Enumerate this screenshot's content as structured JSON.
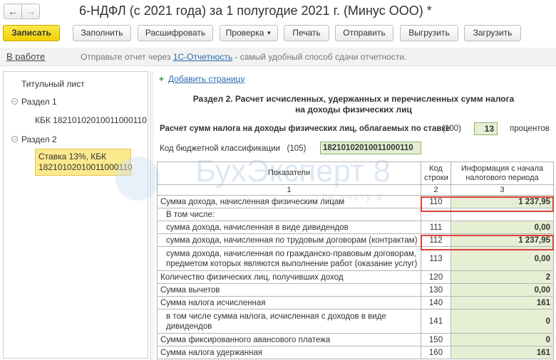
{
  "window": {
    "title": "6-НДФЛ (с 2021 года) за 1 полугодие 2021 г. (Минус ООО) *",
    "back_icon": "←",
    "forward_icon": "→"
  },
  "toolbar": {
    "save": "Записать",
    "fill": "Заполнить",
    "decode": "Расшифровать",
    "check": "Проверка",
    "print": "Печать",
    "send": "Отправить",
    "export": "Выгрузить",
    "import": "Загрузить"
  },
  "status": {
    "state": "В работе",
    "msg_before": "Отправьте отчет через ",
    "msg_link": "1С-Отчетность",
    "msg_after": " - самый удобный способ сдачи отчетности."
  },
  "sidebar": {
    "items": [
      {
        "label": "Титульный лист"
      },
      {
        "label": "Раздел 1"
      },
      {
        "label": "КБК 18210102010011000110"
      },
      {
        "label": "Раздел 2"
      },
      {
        "label_line1": "Ставка 13%, КБК",
        "label_line2": "18210102010011000110"
      }
    ]
  },
  "content": {
    "add_page": "Добавить страницу",
    "section_title_line1": "Раздел 2. Расчет исчисленных, удержанных и перечисленных сумм налога",
    "section_title_line2": "на доходы физических лиц",
    "rate_label": "Расчет сумм налога на доходы физических лиц, облагаемых по ставке",
    "rate_code": "(100)",
    "rate_value": "13",
    "rate_unit": "процентов",
    "kbk_label": "Код бюджетной классификации",
    "kbk_code": "(105)",
    "kbk_value": "18210102010011000110"
  },
  "watermark": {
    "text": "БухЭксперт 8",
    "sub": "по учету в"
  },
  "table": {
    "headers": [
      "Показатели",
      "Код строки",
      "Информация с начала налогового периода"
    ],
    "header_nums": [
      "1",
      "2",
      "3"
    ],
    "rows": [
      {
        "label": "Сумма дохода, начисленная физическим лицам",
        "code": "110",
        "value": "1 237,95"
      },
      {
        "label": "В том числе:",
        "code": "",
        "value": ""
      },
      {
        "label": "сумма дохода, начисленная в виде дивидендов",
        "code": "111",
        "value": "0,00"
      },
      {
        "label": "сумма дохода, начисленная по трудовым договорам (контрактам)",
        "code": "112",
        "value": "1 237,95"
      },
      {
        "label": "сумма дохода, начисленная по гражданско-правовым договорам, предметом которых являются выполнение работ (оказание услуг)",
        "code": "113",
        "value": "0,00"
      },
      {
        "label": "Количество физических лиц, получивших доход",
        "code": "120",
        "value": "2"
      },
      {
        "label": "Сумма вычетов",
        "code": "130",
        "value": "0,00"
      },
      {
        "label": "Сумма налога исчисленная",
        "code": "140",
        "value": "161"
      },
      {
        "label": "в том числе сумма налога, исчисленная с доходов в виде дивидендов",
        "code": "141",
        "value": "0"
      },
      {
        "label": "Сумма фиксированного авансового платежа",
        "code": "150",
        "value": "0"
      },
      {
        "label": "Сумма налога удержанная",
        "code": "160",
        "value": "161"
      }
    ]
  }
}
